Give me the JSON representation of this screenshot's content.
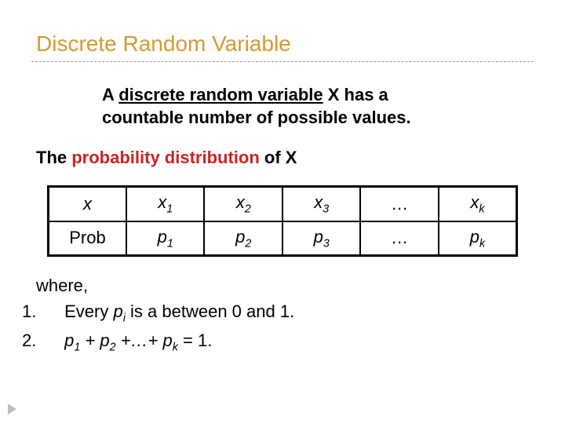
{
  "title": "Discrete Random Variable",
  "definition": {
    "line1_pre": "A ",
    "line1_u": "discrete random variable",
    "line1_post": " X has a",
    "line2": "countable number of possible values."
  },
  "subhead": {
    "t1": "The ",
    "red": "probability distribution",
    "t2": " of X"
  },
  "table": {
    "row1": {
      "h": "x",
      "c1": "x",
      "s1": "1",
      "c2": "x",
      "s2": "2",
      "c3": "x",
      "s3": "3",
      "c4": "…",
      "c5": "x",
      "s5": "k"
    },
    "row2": {
      "h": "Prob",
      "c1": "p",
      "s1": "1",
      "c2": "p",
      "s2": "2",
      "c3": "p",
      "s3": "3",
      "c4": "…",
      "c5": "p",
      "s5": "k"
    }
  },
  "where": {
    "lead": "where,",
    "n1": "1.",
    "item1_a": "Every ",
    "item1_b": "p",
    "item1_sub": "i",
    "item1_c": " is a between 0 and 1.",
    "n2": "2.",
    "item2_a": "p",
    "item2_s1": "1",
    "item2_b": " + p",
    "item2_s2": "2",
    "item2_c": " +…+ p",
    "item2_sk": "k",
    "item2_d": " = 1."
  }
}
